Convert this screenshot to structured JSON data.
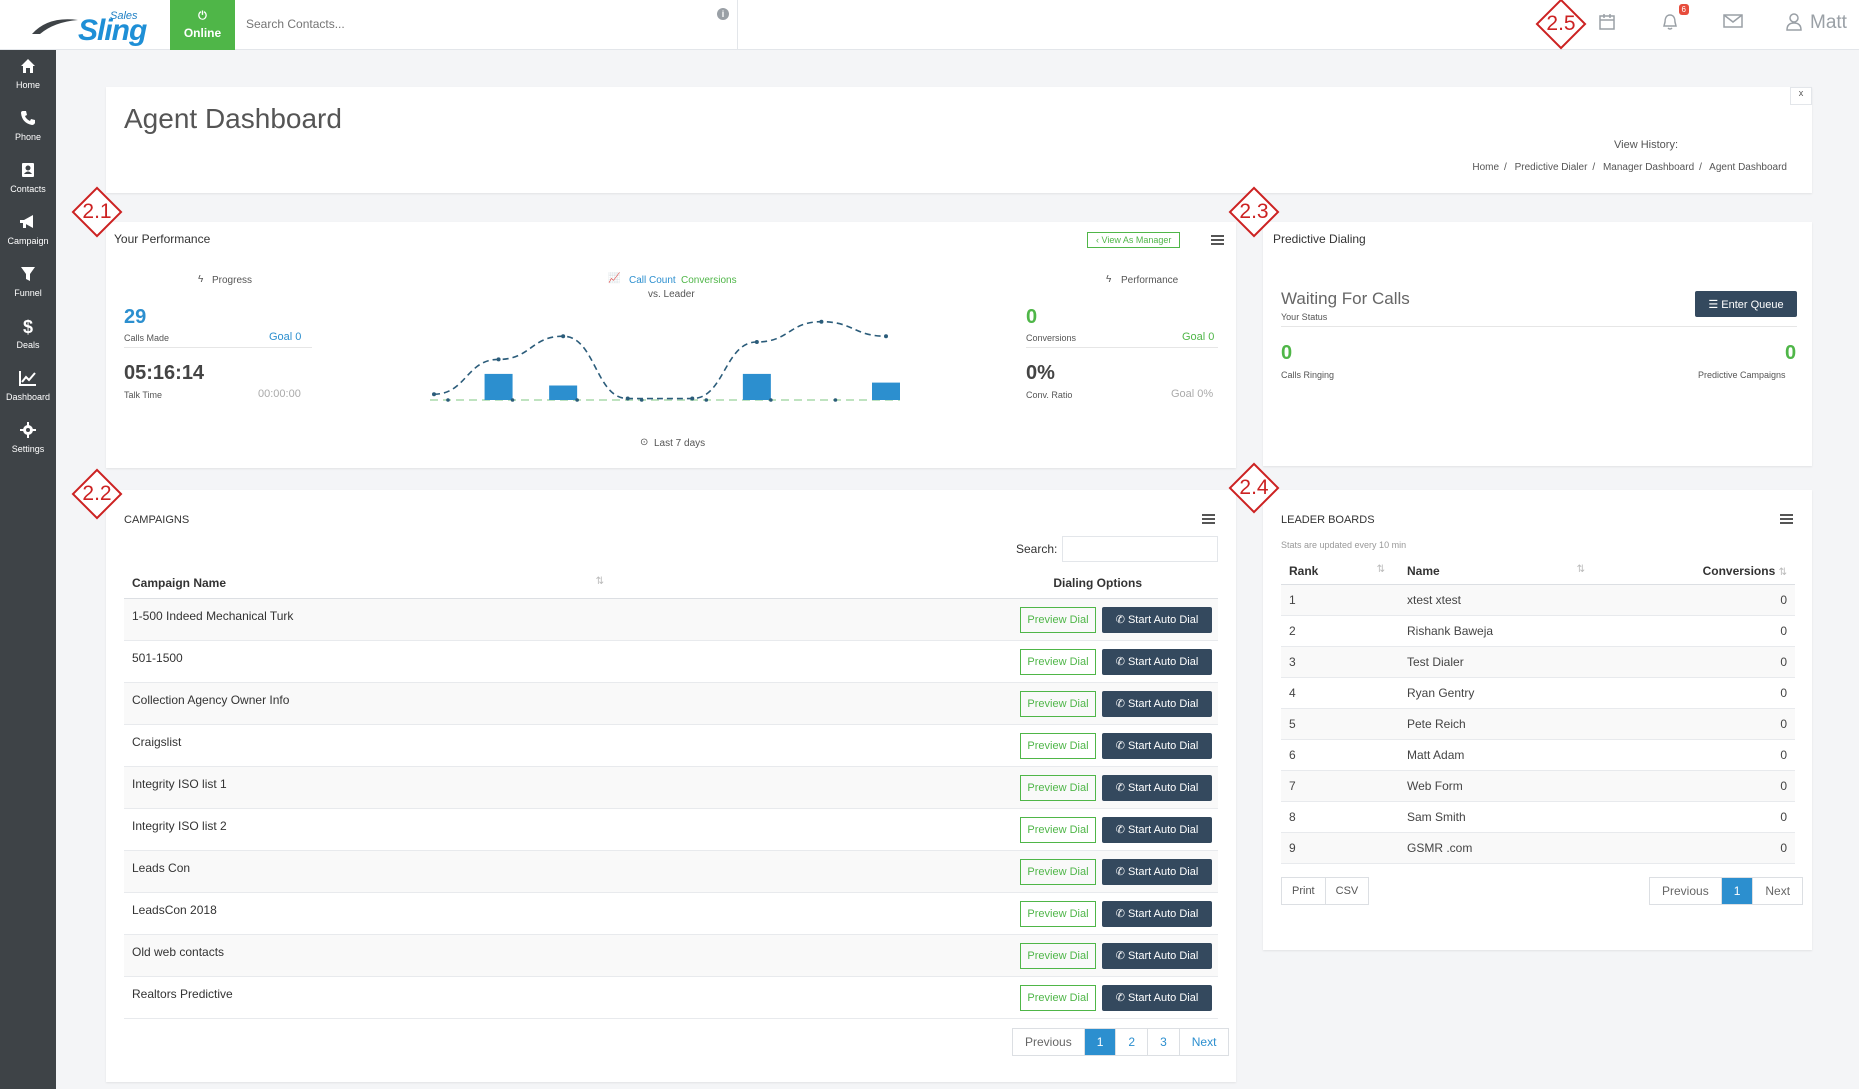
{
  "topbar": {
    "logo_sales": "Sales",
    "logo_sling": "Sling",
    "online_label": "Online",
    "search_placeholder": "Search Contacts...",
    "notification_count": "6",
    "user_name": "Matt"
  },
  "sidebar": {
    "items": [
      {
        "label": "Home",
        "icon": "home-icon"
      },
      {
        "label": "Phone",
        "icon": "phone-icon"
      },
      {
        "label": "Contacts",
        "icon": "contacts-icon"
      },
      {
        "label": "Campaign",
        "icon": "megaphone-icon"
      },
      {
        "label": "Funnel",
        "icon": "funnel-icon"
      },
      {
        "label": "Deals",
        "icon": "dollar-icon"
      },
      {
        "label": "Dashboard",
        "icon": "chart-icon"
      },
      {
        "label": "Settings",
        "icon": "gear-icon"
      }
    ]
  },
  "header": {
    "title": "Agent Dashboard",
    "collapse": "x",
    "view_history": "View History:",
    "breadcrumb": [
      "Home",
      "Predictive Dialer",
      "Manager Dashboard",
      "Agent Dashboard"
    ]
  },
  "performance": {
    "title": "Your Performance",
    "view_as_manager": "View As Manager",
    "progress_label": "Progress",
    "chart_label_a": "Call Count",
    "chart_label_b": "Conversions",
    "chart_label_vs": "vs. Leader",
    "performance_label": "Performance",
    "calls_made_value": "29",
    "calls_made_label": "Calls Made",
    "calls_goal": "Goal 0",
    "talk_time_value": "05:16:14",
    "talk_time_label": "Talk Time",
    "talk_time_goal": "00:00:00",
    "conversions_value": "0",
    "conversions_label": "Conversions",
    "conversions_goal": "Goal 0",
    "conv_ratio_value": "0%",
    "conv_ratio_label": "Conv. Ratio",
    "conv_ratio_goal": "Goal 0%",
    "period": "Last 7 days"
  },
  "chart_data": {
    "type": "bar",
    "categories": [
      "",
      "",
      "",
      "",
      "",
      "",
      "",
      ""
    ],
    "series": [
      {
        "values": [
          0,
          9,
          5,
          0,
          0,
          9,
          0,
          6
        ]
      },
      {
        "values": [
          2,
          14,
          22,
          0.5,
          0.5,
          20,
          27,
          22
        ]
      }
    ],
    "xlabel": "Last 7 days",
    "legend": [
      "Call Count",
      "Conversions",
      "vs. Leader"
    ]
  },
  "predictive": {
    "title": "Predictive Dialing",
    "waiting": "Waiting For Calls",
    "your_status": "Your Status",
    "enter_queue": "Enter Queue",
    "calls_ringing_value": "0",
    "calls_ringing_label": "Calls Ringing",
    "campaigns_value": "0",
    "campaigns_label": "Predictive Campaigns"
  },
  "campaigns": {
    "title": "CAMPAIGNS",
    "search_label": "Search:",
    "col_name": "Campaign Name",
    "col_options": "Dialing Options",
    "preview_label": "Preview Dial",
    "auto_label": "Start Auto Dial",
    "rows": [
      "1-500 Indeed Mechanical Turk",
      "501-1500",
      "Collection Agency Owner Info",
      "Craigslist",
      "Integrity ISO list 1",
      "Integrity ISO list 2",
      "Leads Con",
      "LeadsCon 2018",
      "Old web contacts",
      "Realtors Predictive"
    ],
    "pager": [
      "Previous",
      "1",
      "2",
      "3",
      "Next"
    ]
  },
  "leaderboard": {
    "title": "LEADER BOARDS",
    "subtitle": "Stats are updated every 10 min",
    "col_rank": "Rank",
    "col_name": "Name",
    "col_conv": "Conversions",
    "rows": [
      {
        "rank": "1",
        "name": "xtest xtest",
        "conv": "0"
      },
      {
        "rank": "2",
        "name": "Rishank Baweja",
        "conv": "0"
      },
      {
        "rank": "3",
        "name": "Test Dialer",
        "conv": "0"
      },
      {
        "rank": "4",
        "name": "Ryan Gentry",
        "conv": "0"
      },
      {
        "rank": "5",
        "name": "Pete Reich",
        "conv": "0"
      },
      {
        "rank": "6",
        "name": "Matt Adam",
        "conv": "0"
      },
      {
        "rank": "7",
        "name": "Web Form",
        "conv": "0"
      },
      {
        "rank": "8",
        "name": "Sam Smith",
        "conv": "0"
      },
      {
        "rank": "9",
        "name": "GSMR .com",
        "conv": "0"
      }
    ],
    "export": [
      "Print",
      "CSV"
    ],
    "pager": [
      "Previous",
      "1",
      "Next"
    ]
  },
  "annotations": [
    "2.1",
    "2.2",
    "2.3",
    "2.4",
    "2.5"
  ],
  "colors": {
    "accent": "#2c8fcf",
    "green": "#4fb648",
    "dark_button": "#34495e",
    "annotation": "#cc2222"
  }
}
